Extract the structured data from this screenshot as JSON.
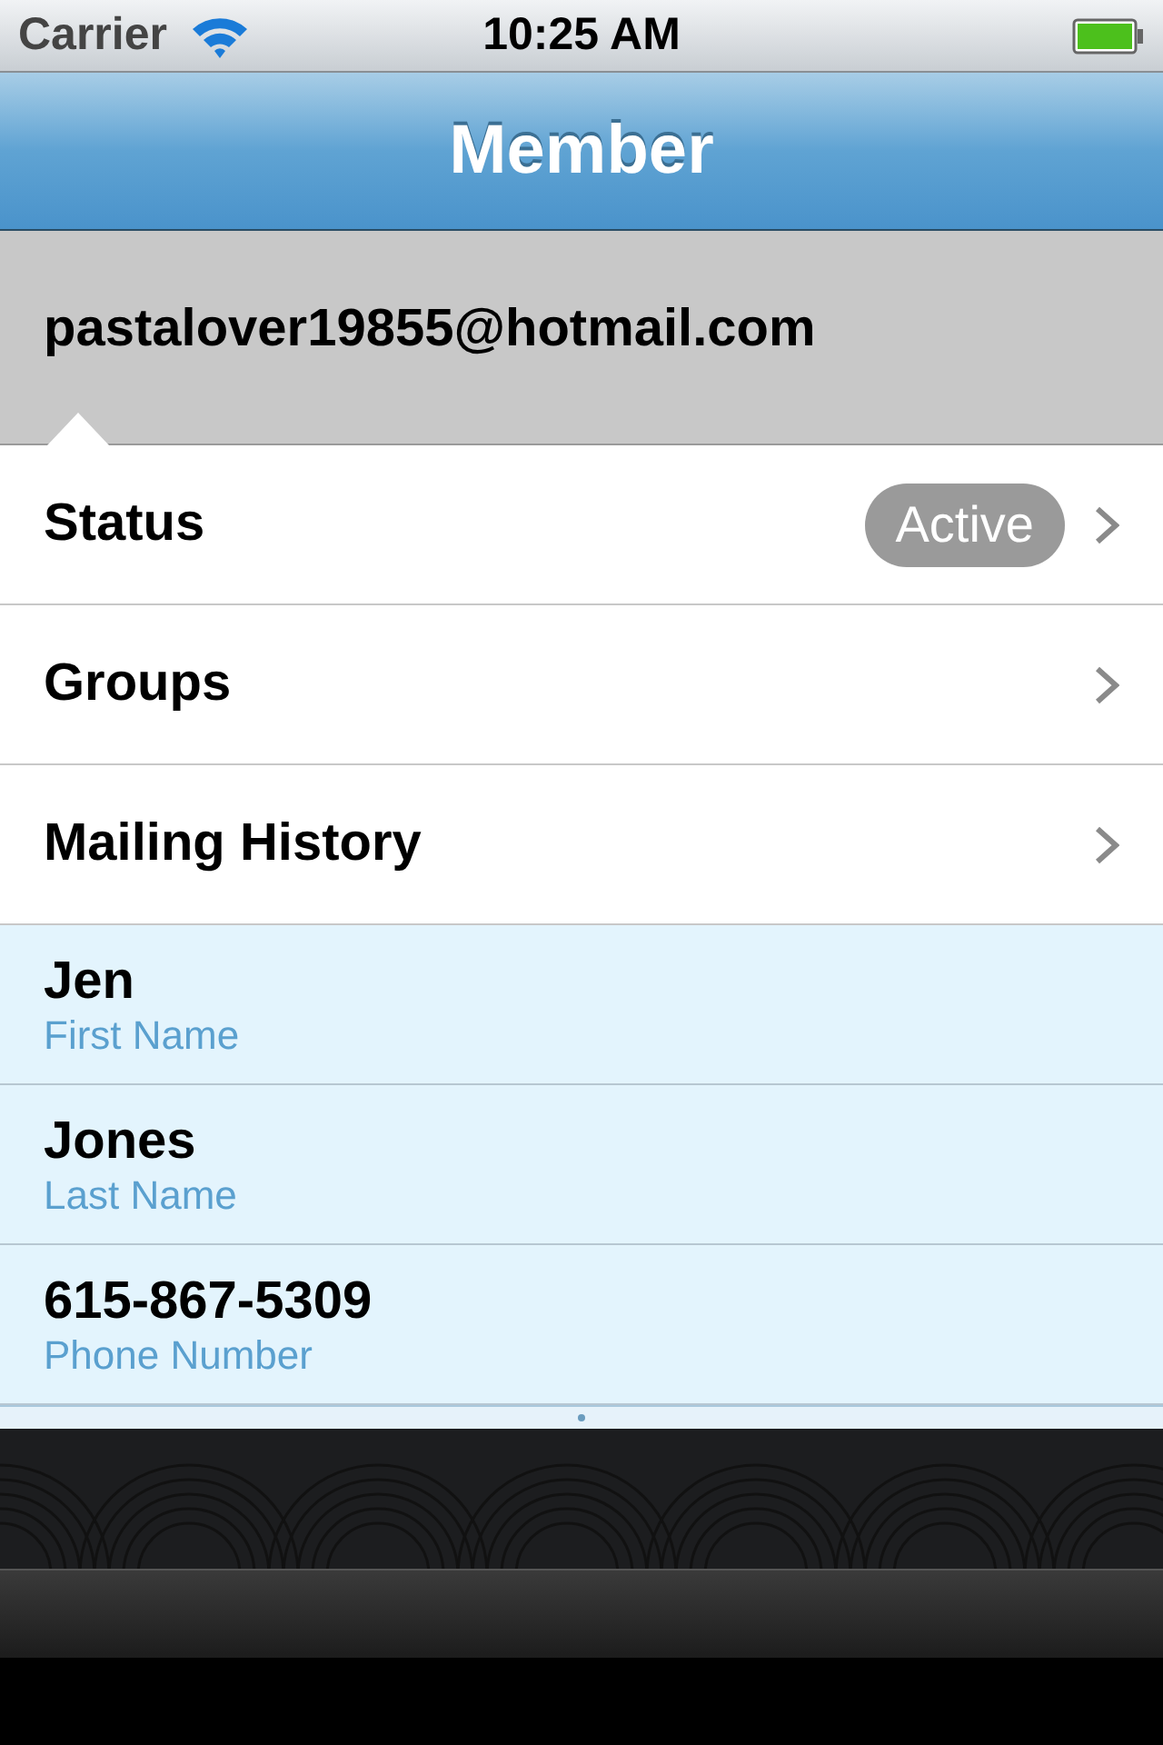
{
  "status_bar": {
    "carrier": "Carrier",
    "time": "10:25 AM"
  },
  "nav_bar": {
    "title": "Member"
  },
  "header": {
    "email": "pastalover19855@hotmail.com"
  },
  "menu_items": [
    {
      "label": "Status",
      "badge": "Active"
    },
    {
      "label": "Groups"
    },
    {
      "label": "Mailing History"
    }
  ],
  "fields": [
    {
      "value": "Jen",
      "label": "First Name"
    },
    {
      "value": "Jones",
      "label": "Last Name"
    },
    {
      "value": "615-867-5309",
      "label": "Phone Number"
    }
  ]
}
